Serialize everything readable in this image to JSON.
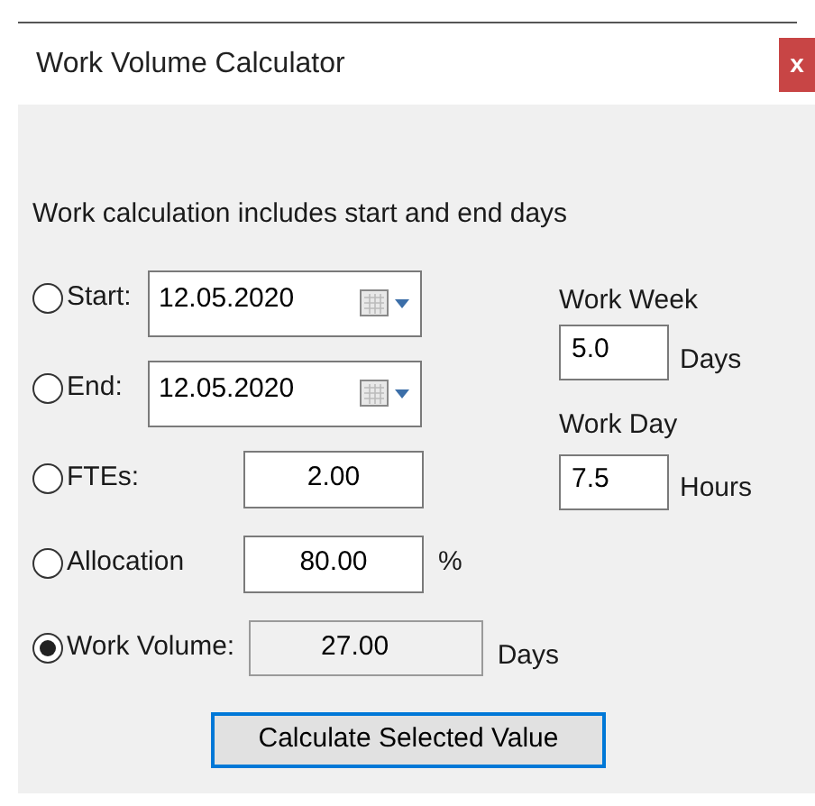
{
  "window": {
    "title": "Work Volume Calculator",
    "close": "x"
  },
  "note": "Work calculation includes start and end days",
  "rows": [
    {
      "kind": "date",
      "label": "Start:",
      "value": "12.05.2020",
      "selected": false
    },
    {
      "kind": "date",
      "label": "End:",
      "value": "12.05.2020",
      "selected": false
    },
    {
      "kind": "number",
      "label": "FTEs:",
      "value": "2.00",
      "selected": false
    },
    {
      "kind": "number",
      "label": "Allocation",
      "value": "80.00",
      "unit": "%",
      "selected": false
    },
    {
      "kind": "readonly",
      "label": "Work Volume:",
      "value": "27.00",
      "unit": "Days",
      "selected": true
    }
  ],
  "work_week": {
    "label": "Work Week",
    "value": "5.0",
    "unit": "Days"
  },
  "work_day": {
    "label": "Work Day",
    "value": "7.5",
    "unit": "Hours"
  },
  "button": "Calculate Selected Value"
}
